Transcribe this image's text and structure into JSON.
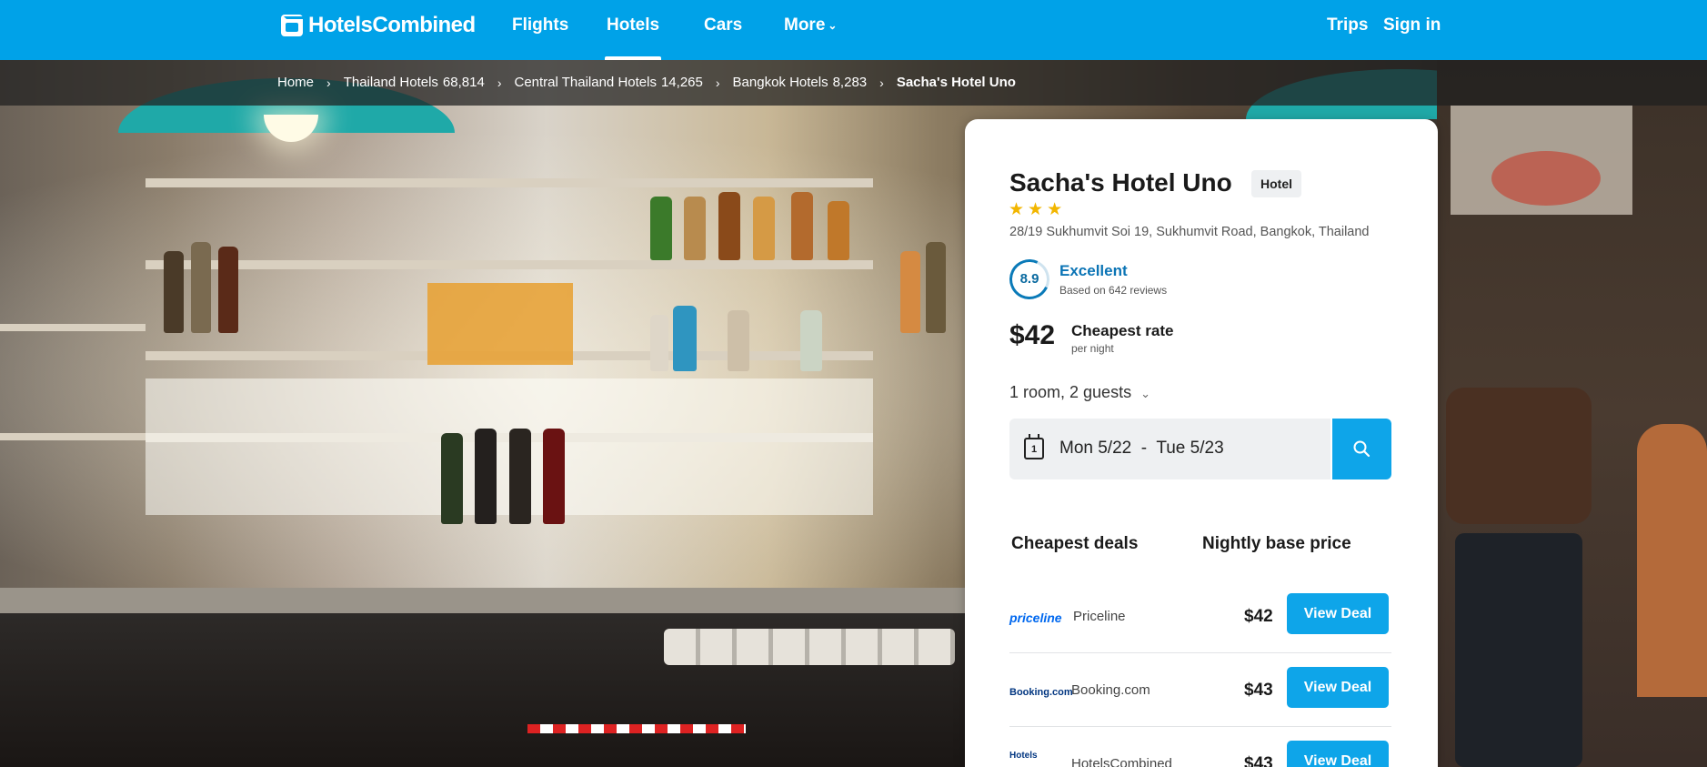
{
  "colors": {
    "brand": "#00a2e8",
    "button": "#0ea5e9",
    "rating": "#0b74b5",
    "stars": "#f2b600"
  },
  "topnav": {
    "logo_a": "Hotels",
    "logo_b": "Combined",
    "items": [
      {
        "label": "Flights"
      },
      {
        "label": "Hotels"
      },
      {
        "label": "Cars"
      },
      {
        "label": "More"
      }
    ],
    "trips": "Trips",
    "signin": "Sign in"
  },
  "breadcrumb": [
    {
      "label": "Home"
    },
    {
      "label": "Thailand Hotels",
      "count": "68,814"
    },
    {
      "label": "Central Thailand Hotels",
      "count": "14,265"
    },
    {
      "label": "Bangkok Hotels",
      "count": "8,283"
    },
    {
      "label": "Sacha's Hotel Uno"
    }
  ],
  "hotel": {
    "name": "Sacha's Hotel Uno",
    "type": "Hotel",
    "stars": "★★★",
    "address": "28/19 Sukhumvit Soi 19, Sukhumvit Road, Bangkok, Thailand",
    "rating_score": "8.9",
    "rating_label": "Excellent",
    "rating_reviews": "Based on 642 reviews",
    "price": "$42",
    "price_label": "Cheapest rate",
    "price_sub": "per night"
  },
  "booking": {
    "guests": "1 room, 2 guests",
    "calendar_day": "1",
    "checkin": "Mon 5/22",
    "checkout": "Tue 5/23"
  },
  "deals": {
    "header_left": "Cheapest deals",
    "header_right": "Nightly base price",
    "rows": [
      {
        "logo": "priceline",
        "provider": "Priceline",
        "price": "$42",
        "button": "View Deal"
      },
      {
        "logo": "Booking.com",
        "provider": "Booking.com",
        "price": "$43",
        "button": "View Deal"
      },
      {
        "logo": "Hotels",
        "provider": "HotelsCombined",
        "price": "$43",
        "button": "View Deal"
      }
    ]
  }
}
